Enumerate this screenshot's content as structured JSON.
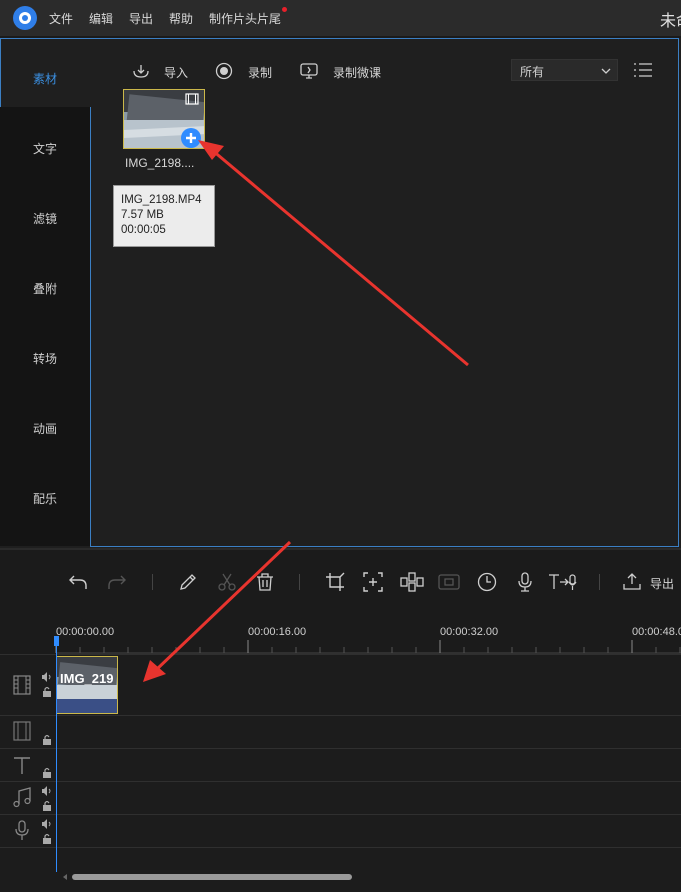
{
  "app": {
    "window_title": "未命"
  },
  "menu": [
    "文件",
    "编辑",
    "导出",
    "帮助",
    "制作片头片尾"
  ],
  "sidebar": {
    "items": [
      "素材",
      "文字",
      "滤镜",
      "叠附",
      "转场",
      "动画",
      "配乐"
    ]
  },
  "library_toolbar": {
    "import": "导入",
    "record": "录制",
    "record_lecture": "录制微课",
    "filter_value": "所有"
  },
  "media": {
    "label": "IMG_2198....",
    "tooltip": {
      "filename": "IMG_2198.MP4",
      "size": "7.57 MB",
      "duration": "00:00:05"
    }
  },
  "timeline": {
    "export_label": "导出",
    "time_labels": [
      "00:00:00.00",
      "00:00:16.00",
      "00:00:32.00",
      "00:00:48.0"
    ],
    "clip_label": "IMG_219"
  },
  "colors": {
    "accent": "#3b7fc4",
    "clip_border": "#cbb84a",
    "playhead": "#2f8cff",
    "arrow": "#e8342e"
  }
}
